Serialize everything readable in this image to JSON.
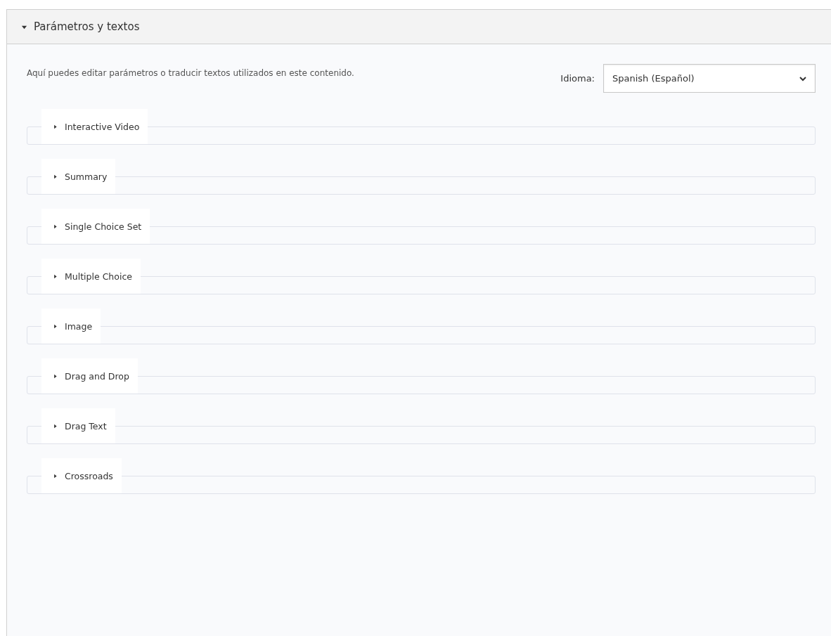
{
  "panel": {
    "title": "Parámetros y textos",
    "expanded": true
  },
  "description": "Aquí puedes editar parámetros o traducir textos utilizados en este contenido.",
  "language": {
    "label": "Idioma:",
    "value": "Spanish (Español)"
  },
  "groups": [
    {
      "label": "Interactive Video",
      "expanded": false
    },
    {
      "label": "Summary",
      "expanded": false
    },
    {
      "label": "Single Choice Set",
      "expanded": false
    },
    {
      "label": "Multiple Choice",
      "expanded": false
    },
    {
      "label": "Image",
      "expanded": false
    },
    {
      "label": "Drag and Drop",
      "expanded": false
    },
    {
      "label": "Drag Text",
      "expanded": false
    },
    {
      "label": "Crossroads",
      "expanded": false
    }
  ]
}
